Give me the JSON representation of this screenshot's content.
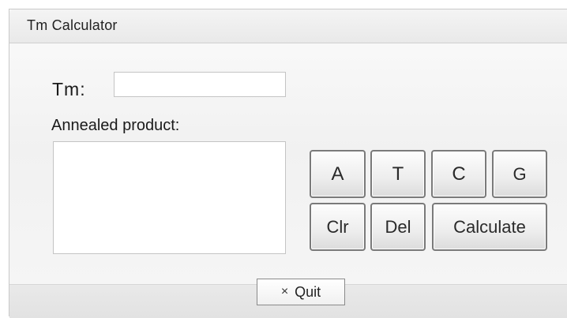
{
  "window": {
    "title": "Tm Calculator"
  },
  "form": {
    "tm_label": "Tm:",
    "tm_value": "",
    "annealed_label": "Annealed product:",
    "annealed_value": ""
  },
  "keypad": {
    "a": "A",
    "t": "T",
    "c": "C",
    "g": "G",
    "clr": "Clr",
    "del": "Del",
    "calculate": "Calculate"
  },
  "footer": {
    "quit_icon": "×",
    "quit_label": "Quit"
  },
  "icons": {
    "quit": "close-icon"
  }
}
